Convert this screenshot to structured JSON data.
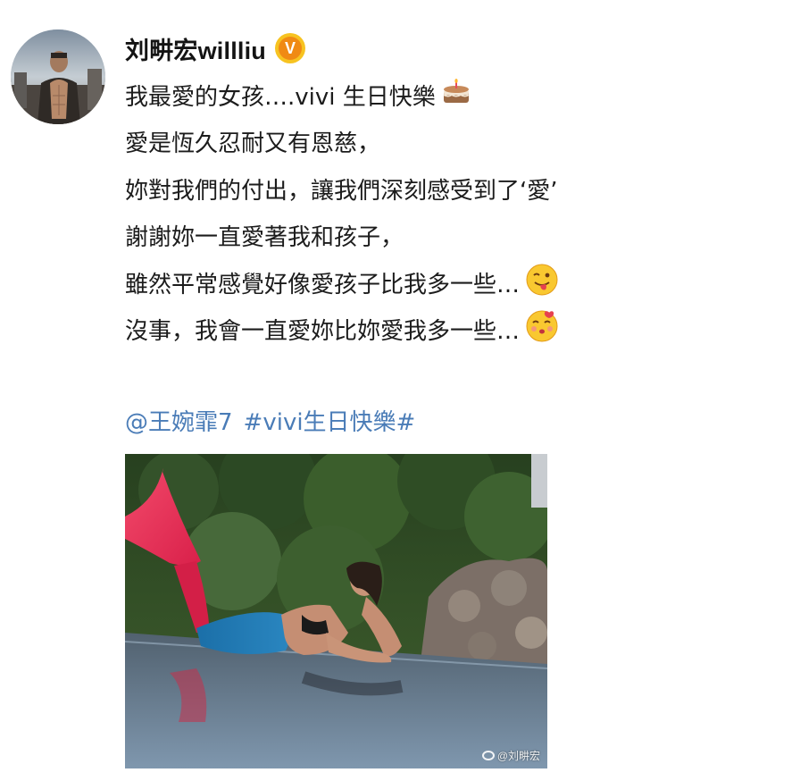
{
  "post": {
    "username": "刘畊宏willliu",
    "verified_badge_letter": "V",
    "avatar_icon": "user-avatar-photo",
    "lines": [
      "我最愛的女孩….vivi 生日快樂",
      "愛是恆久忍耐又有恩慈，",
      "妳對我們的付出，讓我們深刻感受到了‘愛’",
      "謝謝妳一直愛著我和孩子，",
      "雖然平常感覺好像愛孩子比我多一些…",
      "沒事，我會一直愛妳比妳愛我多一些…"
    ],
    "mention": "@王婉霏7",
    "hashtag": "#vivi生日快樂#",
    "photo_watermark": "@刘畊宏",
    "emojis": [
      "cake-icon",
      "tongue-out-emoji-icon",
      "kiss-emoji-icon"
    ]
  },
  "colors": {
    "link": "#4a7cb7",
    "badge_outer": "#f7c321",
    "badge_inner": "#f08a14",
    "text": "#1c1c1c"
  }
}
